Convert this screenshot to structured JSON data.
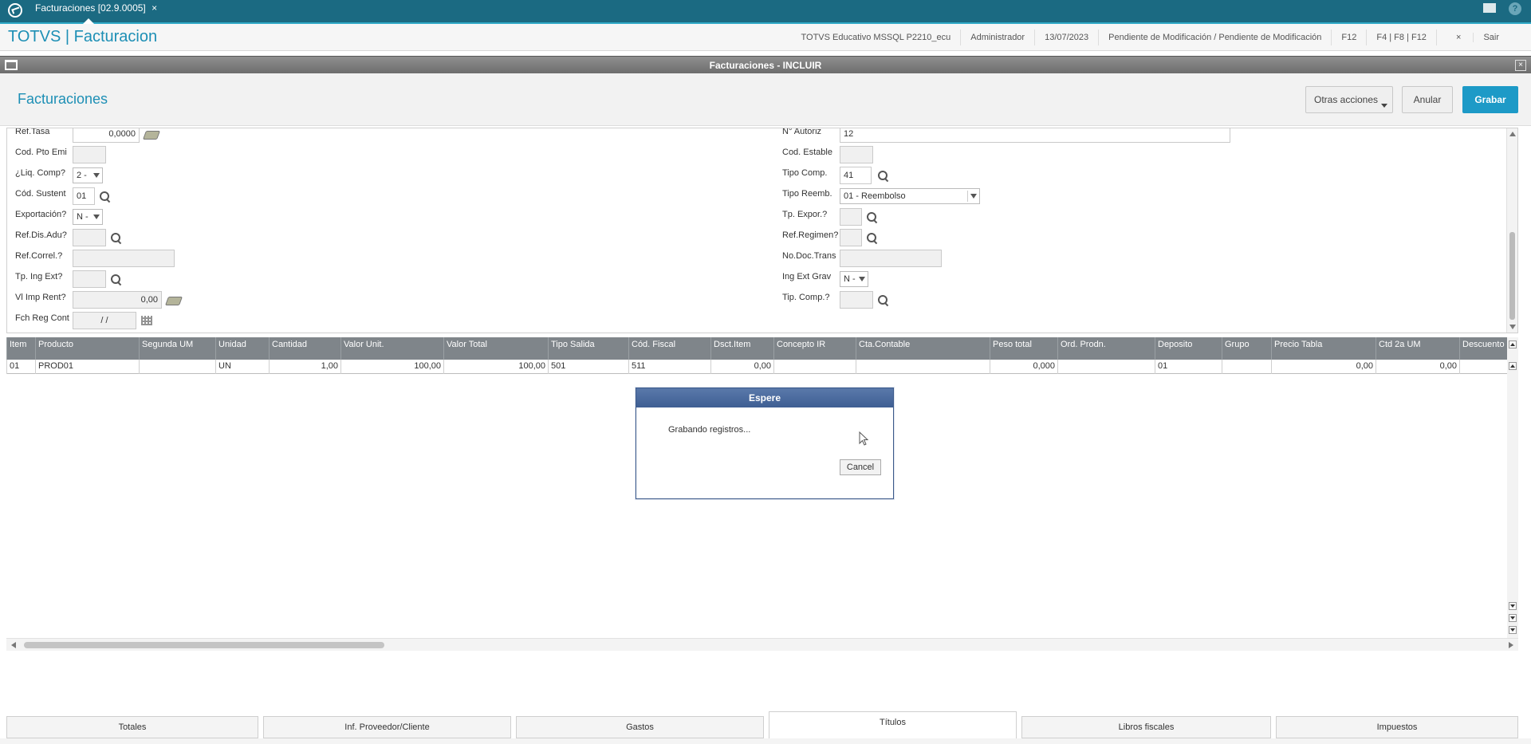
{
  "topbar": {
    "tab_label": "Facturaciones [02.9.0005]",
    "tab_close": "×"
  },
  "app": {
    "title": "TOTVS | Facturacion",
    "environment": "TOTVS Educativo MSSQL P2210_ecu",
    "user": "Administrador",
    "date": "13/07/2023",
    "status": "Pendiente de Modificación / Pendiente de Modificación",
    "shortcut1": "F12",
    "shortcut2": "F4 | F8 | F12",
    "exit": "Sair",
    "exit_icon": "×"
  },
  "window": {
    "title": "Facturaciones - INCLUIR",
    "close": "×"
  },
  "form": {
    "title": "Facturaciones",
    "buttons": {
      "otras": "Otras acciones",
      "anular": "Anular",
      "grabar": "Grabar"
    },
    "left": [
      {
        "label": "Ref.Tasa",
        "value": "0,0000"
      },
      {
        "label": "Cod. Pto Emi",
        "value": ""
      },
      {
        "label": "¿Liq. Comp?",
        "value": "2 -"
      },
      {
        "label": "Cód. Sustent",
        "value": "01"
      },
      {
        "label": "Exportación?",
        "value": "N -"
      },
      {
        "label": "Ref.Dis.Adu?",
        "value": ""
      },
      {
        "label": "Ref.Correl.?",
        "value": ""
      },
      {
        "label": "Tp. Ing Ext?",
        "value": ""
      },
      {
        "label": "Vl Imp Rent?",
        "value": "0,00"
      },
      {
        "label": "Fch Reg Cont",
        "value": "/ /"
      }
    ],
    "right": [
      {
        "label": "N° Autoriz",
        "value": "12"
      },
      {
        "label": "Cod. Estable",
        "value": ""
      },
      {
        "label": "Tipo Comp.",
        "value": "41"
      },
      {
        "label": "Tipo Reemb.",
        "value": "01 - Reembolso"
      },
      {
        "label": "Tp. Expor.?",
        "value": ""
      },
      {
        "label": "Ref.Regimen?",
        "value": ""
      },
      {
        "label": "No.Doc.Trans",
        "value": ""
      },
      {
        "label": "Ing Ext Grav",
        "value": "N -"
      },
      {
        "label": "Tip. Comp.?",
        "value": ""
      }
    ]
  },
  "grid": {
    "columns": [
      "Item",
      "Producto",
      "Segunda UM",
      "Unidad",
      "Cantidad",
      "Valor Unit.",
      "Valor Total",
      "Tipo Salida",
      "Cód. Fiscal",
      "Dsct.Item",
      "Concepto IR",
      "Cta.Contable",
      "Peso total",
      "Ord. Prodn.",
      "Deposito",
      "Grupo",
      "Precio Tabla",
      "Ctd 2a UM",
      "Descuento"
    ],
    "rows": [
      [
        "01",
        "PROD01",
        "",
        "UN",
        "1,00",
        "100,00",
        "100,00",
        "501",
        "511",
        "0,00",
        "",
        "",
        "0,000",
        "",
        "01",
        "",
        "0,00",
        "0,00",
        ""
      ]
    ]
  },
  "dialog": {
    "title": "Espere",
    "message": "Grabando registros...",
    "cancel": "Cancel"
  },
  "tabs": [
    "Totales",
    "Inf. Proveedor/Cliente",
    "Gastos",
    "Títulos",
    "Libros fiscales",
    "Impuestos"
  ],
  "active_tab": "Títulos",
  "colors": {
    "accent": "#1d9ac7",
    "topbar": "#1b6a82",
    "grid_header": "#7f858a",
    "dialog_title": "#3e5e93"
  }
}
